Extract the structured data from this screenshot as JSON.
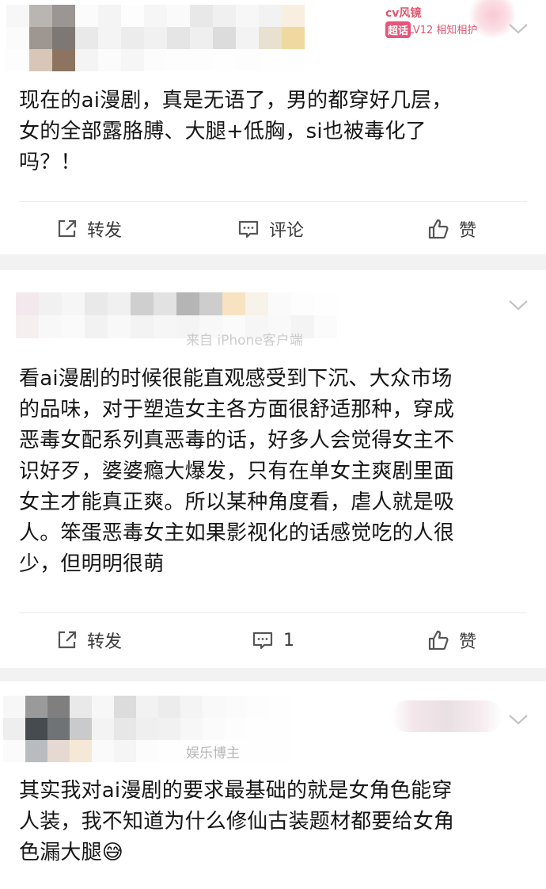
{
  "posts": [
    {
      "badge": {
        "name": "cv风镜",
        "tag": "超话",
        "level_text": "LV12 相知相护"
      },
      "subline": "",
      "text": "现在的ai漫剧，真是无语了，男的都穿好几层，\n女的全部露胳膊、大腿+低胸，si也被毒化了\n吗？！",
      "actions": {
        "repost": "转发",
        "comment": "评论",
        "like": "赞"
      }
    },
    {
      "subline": "来自 iPhone客户端",
      "text": "看ai漫剧的时候很能直观感受到下沉、大众市场\n的品味，对于塑造女主各方面很舒适那种，穿成\n恶毒女配系列真恶毒的话，好多人会觉得女主不\n识好歹，婆婆瘾大爆发，只有在单女主爽剧里面\n女主才能真正爽。所以某种角度看，虐人就是吸\n人。笨蛋恶毒女主如果影视化的话感觉吃的人很\n少，但明明很萌",
      "actions": {
        "repost": "转发",
        "comment": "1",
        "like": "赞"
      }
    },
    {
      "subline": "娱乐博主",
      "text": "其实我对ai漫剧的要求最基础的就是女角色能穿\n人装，我不知道为什么修仙古装题材都要给女角\n色漏大腿😅"
    }
  ],
  "colors": {
    "page_bg": "#f2f2f2",
    "card_bg": "#ffffff",
    "badge_pink": "#e0556f",
    "icon_gray": "#555555"
  },
  "icons": [
    "share-icon",
    "comment-icon",
    "like-icon",
    "chevron-down-icon"
  ]
}
